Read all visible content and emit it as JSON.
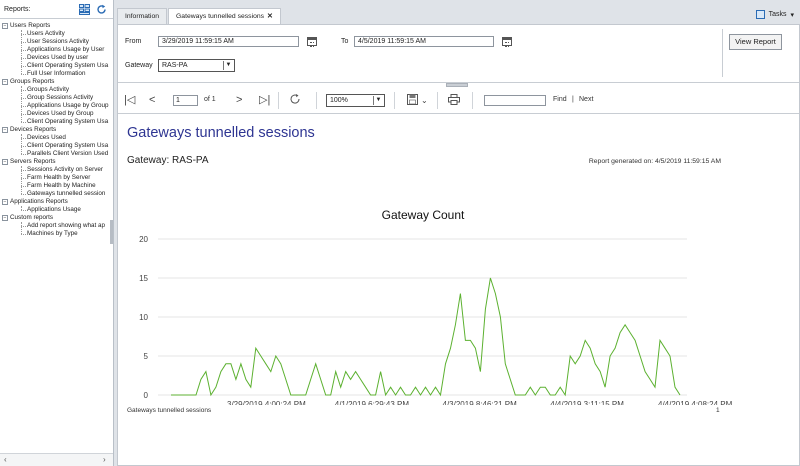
{
  "left_panel": {
    "title": "Reports:",
    "groups": [
      {
        "label": "Users Reports",
        "items": [
          "Users Activity",
          "User Sessions Activity",
          "Applications Usage by User",
          "Devices Used by user",
          "Client Operating System Usa",
          "Full User Information"
        ]
      },
      {
        "label": "Groups Reports",
        "items": [
          "Groups Activity",
          "Group Sessions Activity",
          "Applications Usage by Group",
          "Devices Used by Group",
          "Client Operating System Usa"
        ]
      },
      {
        "label": "Devices Reports",
        "items": [
          "Devices Used",
          "Client Operating System Usa",
          "Parallels Client Version Used"
        ]
      },
      {
        "label": "Servers Reports",
        "items": [
          "Sessions Activity on Server",
          "Farm Health by Server",
          "Farm Health by Machine",
          "Gateways tunnelled session"
        ]
      },
      {
        "label": "Applications Reports",
        "items": [
          "Applications Usage"
        ]
      },
      {
        "label": "Custom reports",
        "items": [
          "Add report showing what ap",
          "Machines by Type"
        ]
      }
    ]
  },
  "tabs": [
    {
      "label": "Information",
      "closable": false
    },
    {
      "label": "Gateways tunnelled sessions",
      "closable": true
    }
  ],
  "tasks_label": "Tasks",
  "params": {
    "from_label": "From",
    "from_value": "3/29/2019 11:59:15 AM",
    "to_label": "To",
    "to_value": "4/5/2019 11:59:15 AM",
    "gateway_label": "Gateway",
    "gateway_value": "RAS-PA",
    "view_report_label": "View Report"
  },
  "toolbar": {
    "page_value": "1",
    "page_of": "of 1",
    "zoom": "100%",
    "find_label": "Find",
    "next_label": "Next",
    "sep": "|"
  },
  "report": {
    "title": "Gateways tunnelled sessions",
    "gateway_line": "Gateway: RAS-PA",
    "generated": "Report generated on: 4/5/2019 11:59:15 AM",
    "footer_left": "Gateways tunnelled sessions",
    "footer_page": "1"
  },
  "chart_data": {
    "type": "line",
    "title": "Gateway Count",
    "xlabel": "",
    "ylabel": "",
    "ylim": [
      0,
      20
    ],
    "yticks": [
      0,
      5,
      10,
      15,
      20
    ],
    "xtick_labels": [
      "3/29/2019 4:00:24 PM",
      "4/1/2019 6:29:43 PM",
      "4/3/2019 8:46:21 PM",
      "4/4/2019 3:11:15 PM",
      "4/4/2019 4:08:24 PM"
    ],
    "grid": true,
    "color": "#5cb130",
    "series": [
      {
        "values": [
          0,
          0,
          0,
          0,
          0,
          0,
          2,
          3,
          0,
          1,
          3,
          4,
          4,
          2,
          4,
          2,
          1,
          6,
          5,
          4,
          3,
          5,
          4,
          2,
          0,
          0,
          0,
          0,
          2,
          4,
          2,
          0,
          0,
          3,
          1,
          3,
          2,
          3,
          2,
          1,
          0,
          0,
          3,
          0,
          1,
          0,
          1,
          0,
          0,
          1,
          0,
          1,
          0,
          1,
          0,
          4,
          6,
          9,
          13,
          7,
          7,
          6,
          3,
          11,
          15,
          13,
          10,
          4,
          2,
          0,
          0,
          0,
          1,
          0,
          1,
          1,
          0,
          0,
          1,
          0,
          5,
          4,
          5,
          7,
          6,
          4,
          3,
          1,
          5,
          6,
          8,
          9,
          8,
          7,
          5,
          3,
          2,
          1,
          7,
          6,
          5,
          1,
          0
        ]
      }
    ]
  }
}
